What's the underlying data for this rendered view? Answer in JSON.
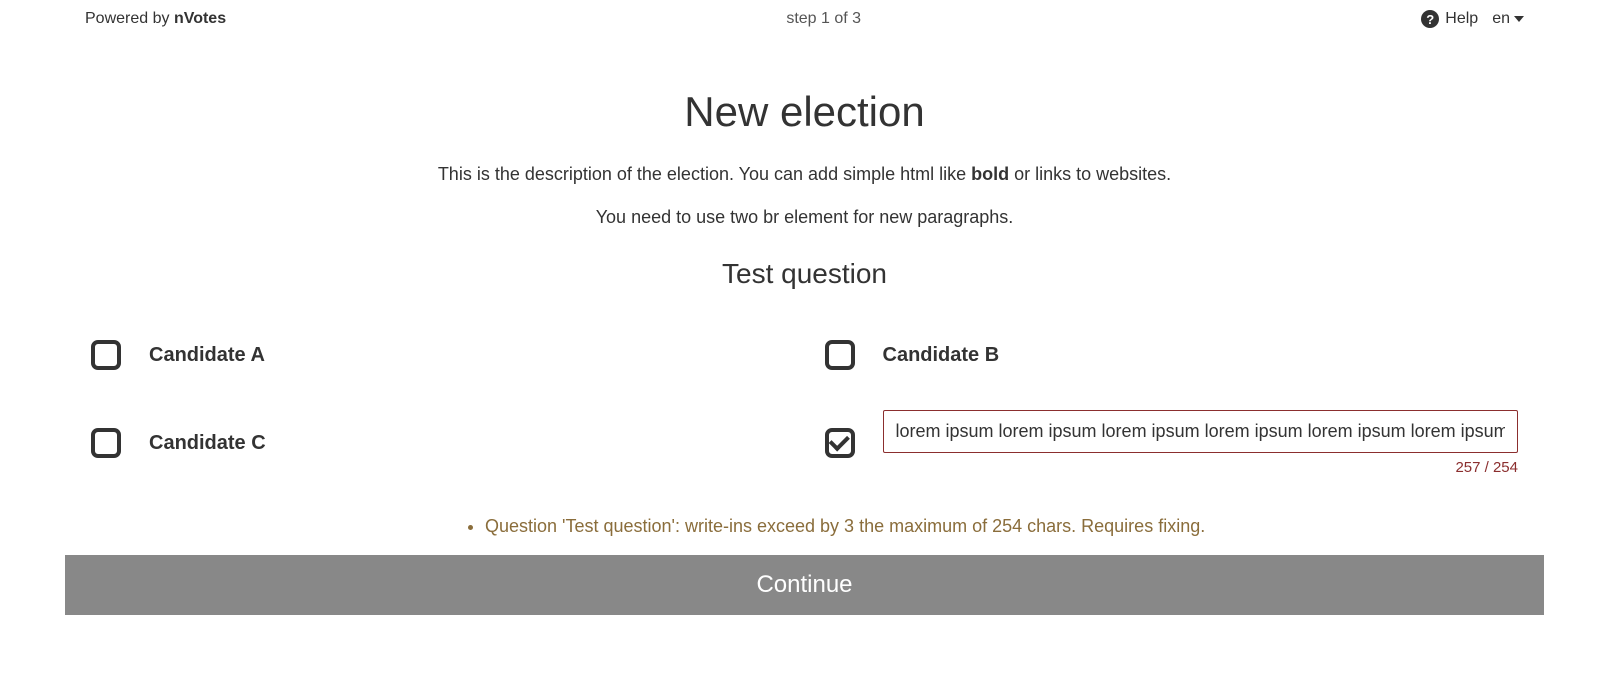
{
  "header": {
    "powered_by_prefix": "Powered by ",
    "powered_by_brand": "nVotes",
    "step_text": "step 1 of 3",
    "help_label": "Help",
    "lang_label": "en"
  },
  "main": {
    "title": "New election",
    "description_prefix": "This is the description of the election. You can add simple html like ",
    "description_bold": "bold",
    "description_suffix": " or links to websites.",
    "description_line2": "You need to use two br element for new paragraphs.",
    "question_title": "Test question"
  },
  "options": {
    "a": {
      "label": "Candidate A"
    },
    "b": {
      "label": "Candidate B"
    },
    "c": {
      "label": "Candidate C"
    },
    "writein": {
      "value": "lorem ipsum lorem ipsum lorem ipsum lorem ipsum lorem ipsum lorem ipsum",
      "char_count": "257 / 254"
    }
  },
  "errors": {
    "item1": "Question 'Test question': write-ins exceed by 3 the maximum of 254 chars. Requires fixing."
  },
  "footer": {
    "continue_label": "Continue"
  }
}
